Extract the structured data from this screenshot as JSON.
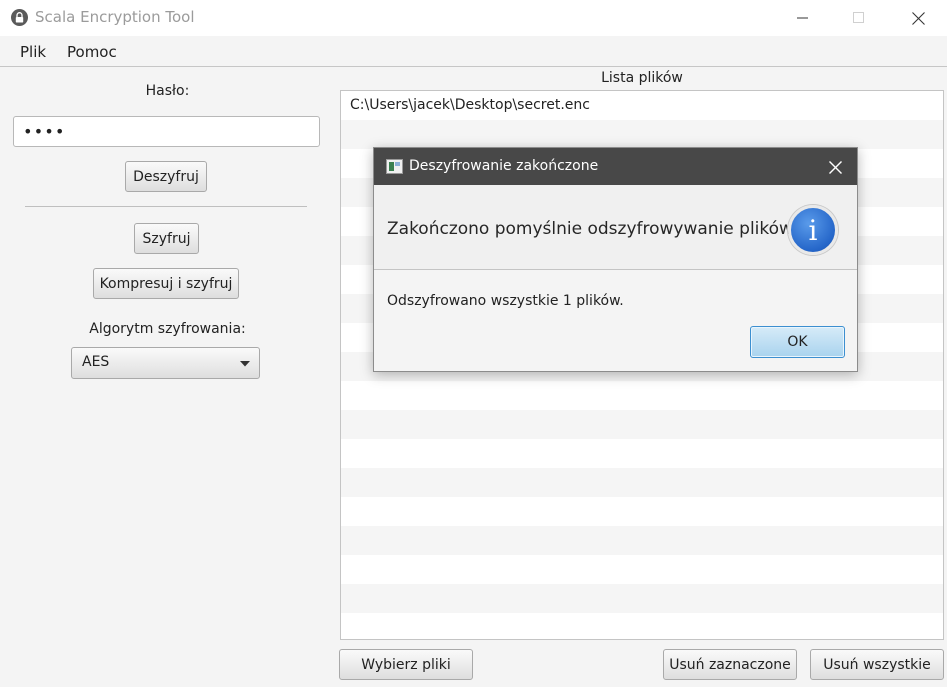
{
  "window": {
    "title": "Scala Encryption Tool",
    "icon": "lock-icon"
  },
  "menu": {
    "items": [
      {
        "label": "Plik"
      },
      {
        "label": "Pomoc"
      }
    ]
  },
  "left_panel": {
    "password_label": "Hasło:",
    "password_value": "••••",
    "decrypt_label": "Deszyfruj",
    "encrypt_label": "Szyfruj",
    "compress_encrypt_label": "Kompresuj i szyfruj",
    "algorithm_label": "Algorytm szyfrowania:",
    "algorithm_selected": "AES"
  },
  "file_list": {
    "title": "Lista plików",
    "files": [
      "C:\\Users\\jacek\\Desktop\\secret.enc"
    ]
  },
  "bottom_buttons": {
    "choose_files": "Wybierz pliki",
    "remove_selected": "Usuń zaznaczone",
    "remove_all": "Usuń wszystkie"
  },
  "dialog": {
    "title": "Deszyfrowanie zakończone",
    "heading": "Zakończono pomyślnie odszyfrowywanie plików",
    "message": "Odszyfrowano wszystkie 1 plików.",
    "ok_label": "OK",
    "icon": "info-icon",
    "icon_glyph": "i"
  },
  "colors": {
    "dialog_titlebar": "#484848",
    "ok_button_border": "#3c8fd0",
    "info_icon": "#2566c9"
  }
}
